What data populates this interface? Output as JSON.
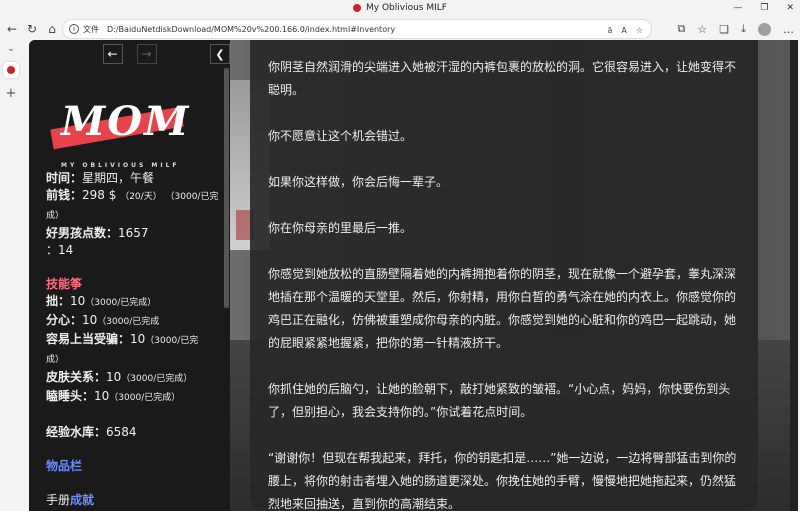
{
  "window": {
    "title": "My Oblivious MILF"
  },
  "address": {
    "info_label": "i",
    "file_label": "文件",
    "url": "D:/BaiduNetdiskDownload/MOM%20v%200.166.0/index.html#Inventory"
  },
  "sidebar": {
    "logo_title": "MOM",
    "logo_subtitle": "MY OBLIVIOUS MILF",
    "lines": {
      "time_label": "时间：",
      "time_value": "星期四，午餐",
      "money_label": "前钱：",
      "money_value": "298 $",
      "money_note": "（20/天）",
      "money_note2": "（3000/已完",
      "money_note3": "成）",
      "good_boy_label": "好男孩点数：",
      "good_boy_value": "1657",
      "line_colon": "：14",
      "skills_heading": "技能筝",
      "skill1_label": "拙：",
      "skill1_value": "10",
      "skill1_note": "（3000/已完成）",
      "skill2_label": "分心：",
      "skill2_value": "10",
      "skill2_note": "（3000/已完成",
      "skill3_label": "容易上当受骗：",
      "skill3_value": "10",
      "skill3_note": "（3000/已完",
      "skill3_note2": "成）",
      "skill4_label": "皮肤关系：",
      "skill4_value": "10",
      "skill4_note": "（3000/已完成）",
      "skill5_label": "瞌睡头：",
      "skill5_value": "10",
      "skill5_note": "（3000/已完成）",
      "exp_label": "经验水库：",
      "exp_value": "6584",
      "inventory_link": "物品栏",
      "manual_label": "手册",
      "achievements_link": "成就"
    }
  },
  "content": {
    "paragraphs": [
      "你阴茎自然润滑的尖端进入她被汗湿的内裤包裹的放松的洞。它很容易进入，让她变得不聪明。",
      "你不愿意让这个机会错过。",
      "如果你这样做，你会后悔一辈子。",
      "你在你母亲的里最后一推。",
      "你感觉到她放松的直肠壁隔着她的内裤拥抱着你的阴茎，现在就像一个避孕套，睾丸深深地插在那个温暖的天堂里。然后，你射精，用你白皙的勇气涂在她的内衣上。你感觉你的鸡巴正在融化，仿佛被重塑成你母亲的内脏。你感觉到她的心脏和你的鸡巴一起跳动，她的屁眼紧紧地握紧，把你的第一针精液挤干。",
      "你抓住她的后脑勺，让她的脸朝下，敲打她紧致的皱褶。“小心点，妈妈，你快要伤到头了，但别担心，我会支持你的。”你试着花点时间。",
      "“谢谢你！但现在帮我起来，拜托，你的钥匙扣是……”她一边说，一边将臀部猛击到你的腰上，将你的射击者埋入她的肠道更深处。你挽住她的手臂，慢慢地把她拖起来，仍然猛烈地来回抽送，直到你的高潮结束。"
    ]
  }
}
